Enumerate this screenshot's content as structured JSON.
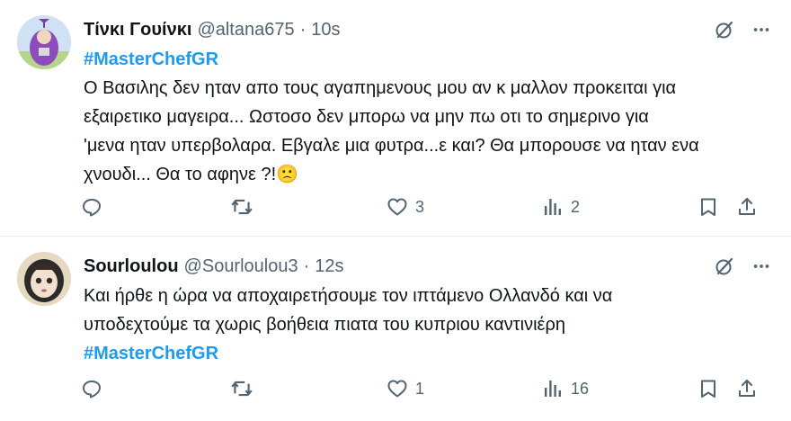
{
  "tweets": [
    {
      "display_name": "Τίνκι Γουίνκι",
      "handle": "@altana675",
      "separator": "·",
      "time": "10s",
      "hashtag_top": "#MasterChefGR",
      "lines": [
        "Ο Βασιλης δεν ηταν απο τους αγαπημενους μου αν κ μαλλον προκειται για",
        "εξαιρετικο μαγειρα... Ωστοσο δεν μπορω να μην πω οτι το σημερινο για",
        "'μενα ηταν υπερβολαρα. Εβγαλε μια φυτρα...ε και? Θα μπορουσε να ηταν ενα",
        "χνουδι... Θα το αφηνε ?!🙁"
      ],
      "replies": "",
      "retweets": "",
      "likes": "3",
      "views": "2",
      "avatar_icon": "teletubby-avatar"
    },
    {
      "display_name": "Sourloulou",
      "handle": "@Sourloulou3",
      "separator": "·",
      "time": "12s",
      "lines": [
        "Και ήρθε η ώρα να αποχαιρετήσουμε τον ιπτάμενο Ολλανδό και να",
        "υποδεχτούμε τα χωρις βοήθεια πιατα του κυπριου καντινιέρη"
      ],
      "hashtag_bottom": "#MasterChefGR",
      "replies": "",
      "retweets": "",
      "likes": "1",
      "views": "16",
      "avatar_icon": "doll-avatar"
    }
  ],
  "colors": {
    "text": "#0f1419",
    "secondary": "#536471",
    "link": "#1d9bf0",
    "divider": "#e6ecf0"
  },
  "icons": [
    "grok-icon",
    "more-icon",
    "reply-icon",
    "retweet-icon",
    "like-icon",
    "views-icon",
    "bookmark-icon",
    "share-icon"
  ]
}
